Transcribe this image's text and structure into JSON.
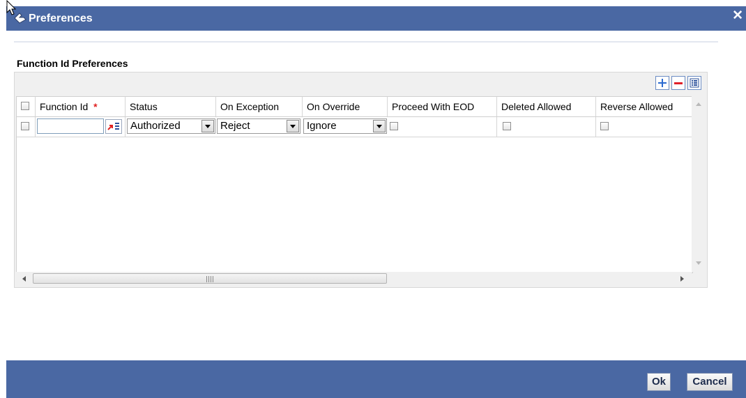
{
  "window": {
    "title": "Preferences",
    "close_glyph": "✕"
  },
  "section": {
    "title": "Function Id Preferences"
  },
  "toolbar": {
    "add_icon": "plus-icon",
    "remove_icon": "minus-icon",
    "view_icon": "single-view-icon"
  },
  "grid": {
    "columns": [
      {
        "label": ""
      },
      {
        "label": "Function Id",
        "required_mark": "*"
      },
      {
        "label": "Status"
      },
      {
        "label": "On Exception"
      },
      {
        "label": "On Override"
      },
      {
        "label": "Proceed With EOD"
      },
      {
        "label": "Deleted Allowed"
      },
      {
        "label": "Reverse Allowed"
      }
    ],
    "rows": [
      {
        "selected": false,
        "function_id": "",
        "status": "Authorized",
        "on_exception": "Reject",
        "on_override": "Ignore",
        "proceed_with_eod": false,
        "deleted_allowed": false,
        "reverse_allowed": false
      }
    ]
  },
  "footer": {
    "ok_label": "Ok",
    "cancel_label": "Cancel"
  },
  "colors": {
    "titlebar": "#4a68a3",
    "footer": "#4a68a3",
    "required": "#e02020"
  }
}
